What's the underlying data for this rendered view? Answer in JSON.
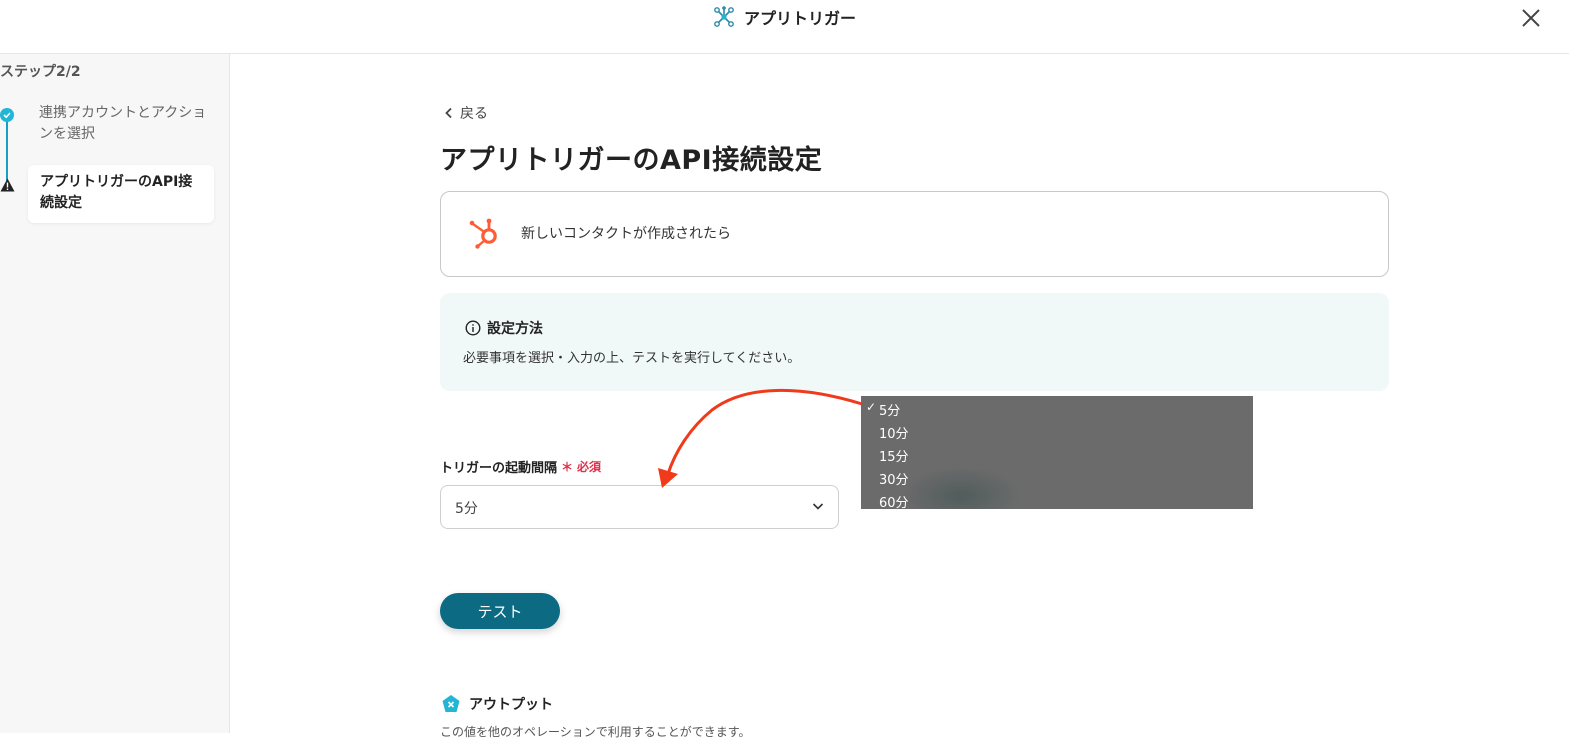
{
  "header": {
    "app_title": "アプリトリガー",
    "close_icon": "close-icon",
    "app_icon": "network-icon"
  },
  "sidebar": {
    "step_label": "ステップ2/2",
    "steps": [
      {
        "label": "連携アカウントとアクションを選択",
        "status": "complete",
        "icon": "check-icon"
      },
      {
        "label": "アプリトリガーのAPI接続設定",
        "status": "current-warning",
        "icon": "warning-icon"
      }
    ]
  },
  "main": {
    "back_label": "戻る",
    "page_title": "アプリトリガーのAPI接続設定",
    "trigger_card": {
      "name": "新しいコンタクトが作成されたら",
      "icon": "hubspot-icon",
      "accent": "#ff5c35"
    },
    "info": {
      "title": "設定方法",
      "description": "必要事項を選択・入力の上、テストを実行してください。",
      "icon": "info-icon"
    },
    "interval_field": {
      "label": "トリガーの起動間隔",
      "required_mark": "＊",
      "required_text": "必須",
      "selected_value": "5分"
    },
    "dropdown": {
      "options": [
        {
          "label": "5分",
          "selected": true
        },
        {
          "label": "10分",
          "selected": false
        },
        {
          "label": "15分",
          "selected": false
        },
        {
          "label": "30分",
          "selected": false
        },
        {
          "label": "60分",
          "selected": false
        }
      ],
      "check_glyph": "✓"
    },
    "test_button": "テスト",
    "output": {
      "title": "アウトプット",
      "description": "この値を他のオペレーションで利用することができます。",
      "icon": "output-icon"
    }
  },
  "colors": {
    "primary": "#0c6a82",
    "step_accent": "#22b5d6",
    "required": "#e0304a",
    "annotation_arrow": "#f03a1a",
    "info_bg": "#f1f8f8"
  }
}
